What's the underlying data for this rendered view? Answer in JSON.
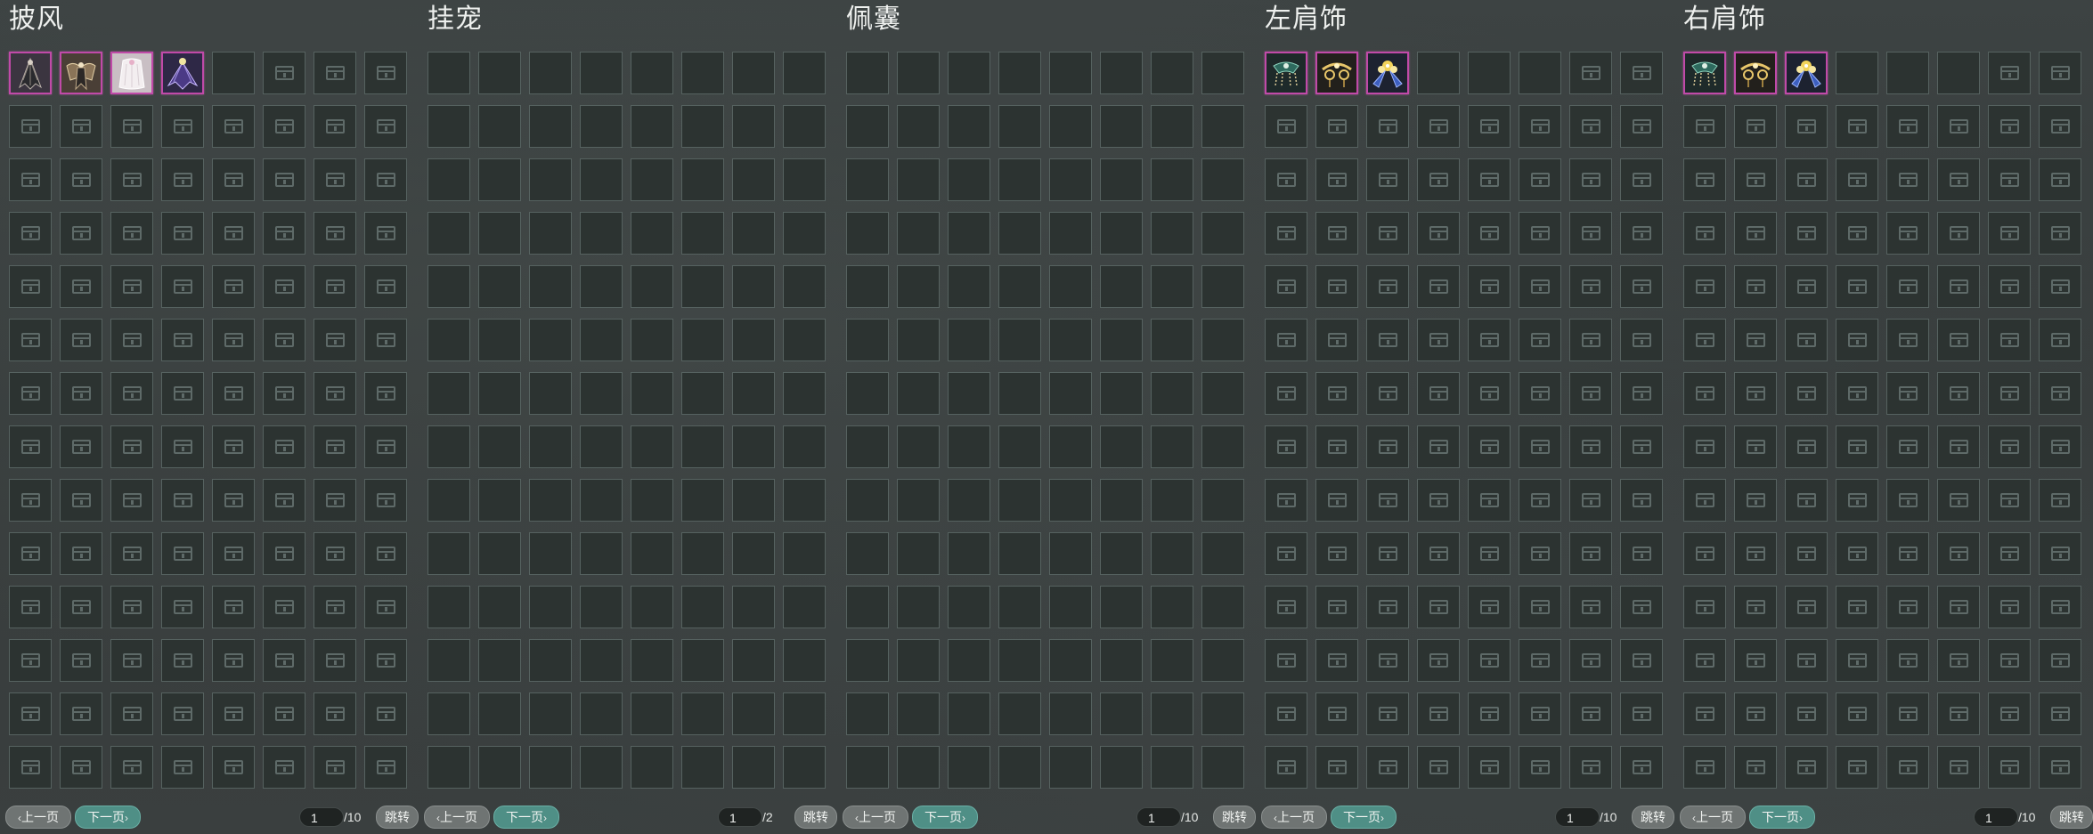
{
  "panels": [
    {
      "title": "披风",
      "prev_label": "上一页",
      "next_label": "下一页",
      "page_current": "1",
      "page_total": "/10",
      "jump_label": "跳转",
      "items": [
        "cloak-dark-wings",
        "cloak-angel-gold",
        "cloak-white-fur",
        "cloak-purple-wings"
      ],
      "open_empty": 1,
      "locked_fill": true
    },
    {
      "title": "挂宠",
      "prev_label": "上一页",
      "next_label": "下一页",
      "page_current": "1",
      "page_total": "/2",
      "jump_label": "跳转",
      "items": [],
      "open_empty": 112,
      "locked_fill": false
    },
    {
      "title": "佩囊",
      "prev_label": "上一页",
      "next_label": "下一页",
      "page_current": "1",
      "page_total": "/10",
      "jump_label": "跳转",
      "items": [],
      "open_empty": 112,
      "locked_fill": false
    },
    {
      "title": "左肩饰",
      "prev_label": "上一页",
      "next_label": "下一页",
      "page_current": "1",
      "page_total": "/10",
      "jump_label": "跳转",
      "items": [
        "shoulder-green-chain",
        "shoulder-gold-chain",
        "shoulder-blue-flower"
      ],
      "open_empty": 3,
      "locked_fill": true
    },
    {
      "title": "右肩饰",
      "prev_label": "上一页",
      "next_label": "下一页",
      "page_current": "1",
      "page_total": "/10",
      "jump_label": "跳转",
      "items": [
        "shoulder-green-chain",
        "shoulder-gold-chain",
        "shoulder-blue-flower"
      ],
      "open_empty": 3,
      "locked_fill": true
    }
  ],
  "colors": {
    "item_border": "#c04aa8",
    "next_button": "#4f8f86",
    "prev_button": "#6f7473"
  },
  "slots_per_page": 112,
  "icons": {
    "locked_slot": "chest-lock-icon",
    "prev_chevron": "chevron-left-icon",
    "next_chevron": "chevron-right-icon"
  }
}
